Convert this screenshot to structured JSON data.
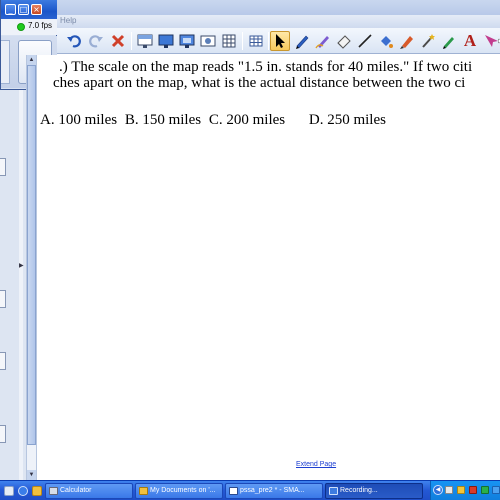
{
  "app": {
    "menu_help": "Help"
  },
  "mini_window": {
    "fps": "7.0 fps",
    "minimize_glyph": "_",
    "restore_glyph": "□",
    "close_glyph": "×"
  },
  "toolbar": {
    "icons": [
      "undo-icon",
      "redo-icon",
      "delete-icon",
      "screen-shade-icon",
      "display-icon",
      "capture-icon",
      "camera-icon",
      "table-insert-icon",
      "table-icon",
      "select-arrow-icon",
      "pen-icon",
      "creative-pen-icon",
      "eraser-icon",
      "line-icon",
      "fill-icon",
      "highlighter-icon",
      "magic-pen-icon",
      "shape-recognition-icon",
      "text-icon",
      "pointer-icon",
      "more-icon"
    ],
    "text_tool_glyph": "A"
  },
  "question": {
    "line1": ".) The scale on the map reads \"1.5 in. stands for 40 miles.\" If two citi",
    "line2": "ches apart on the map, what is the actual distance between the two ci",
    "choices": [
      {
        "label": "A. 100 miles"
      },
      {
        "label": "B. 150 miles"
      },
      {
        "label": "C. 200 miles"
      },
      {
        "label": "D. 250 miles"
      }
    ]
  },
  "page": {
    "extend_link": "Extend Page"
  },
  "taskbar": {
    "buttons": [
      {
        "label": "Calculator",
        "icon": "calculator-icon"
      },
      {
        "label": "My Documents on '...",
        "icon": "folder-icon"
      },
      {
        "label": "pssa_pre2 * - SMA...",
        "icon": "notebook-icon"
      },
      {
        "label": "Recording...",
        "icon": "recording-icon"
      }
    ]
  },
  "colors": {
    "accent_blue": "#1b56c9",
    "taskbar_blue": "#2458d4",
    "link_blue": "#1d3fd1",
    "fps_indicator_green": "#1ecb1e"
  }
}
